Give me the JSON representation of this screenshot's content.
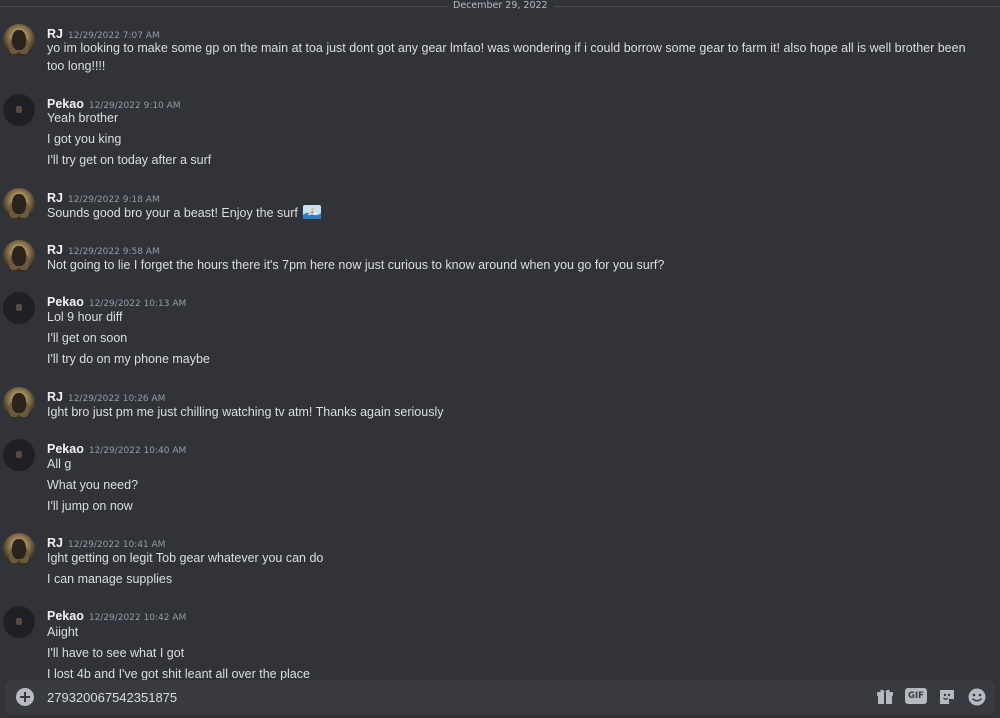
{
  "date_divider": "December 29, 2022",
  "groups": [
    {
      "author": "RJ",
      "timestamp": "12/29/2022 7:07 AM",
      "lines": [
        "yo im looking to make some gp on the main at toa just dont got any gear lmfao! was wondering if i could borrow some gear to farm it! also hope all is well brother been too long!!!!"
      ]
    },
    {
      "author": "Pekao",
      "timestamp": "12/29/2022 9:10 AM",
      "lines": [
        "Yeah brother",
        "I got you king",
        "I'll try get on today after a surf"
      ]
    },
    {
      "author": "RJ",
      "timestamp": "12/29/2022 9:18 AM",
      "lines": [
        "Sounds good bro your a beast! Enjoy the surf"
      ]
    },
    {
      "author": "RJ",
      "timestamp": "12/29/2022 9:58 AM",
      "lines": [
        "Not going to lie I forget the hours there it's 7pm here now just curious to know around when you go for you surf?"
      ]
    },
    {
      "author": "Pekao",
      "timestamp": "12/29/2022 10:13 AM",
      "lines": [
        "Lol 9 hour diff",
        "I'll get on soon",
        "I'll try do on my phone maybe"
      ]
    },
    {
      "author": "RJ",
      "timestamp": "12/29/2022 10:26 AM",
      "lines": [
        "Ight bro just pm me just chilling watching tv atm! Thanks again seriously"
      ]
    },
    {
      "author": "Pekao",
      "timestamp": "12/29/2022 10:40 AM",
      "lines": [
        "All g",
        "What you need?",
        "I'll jump on now"
      ]
    },
    {
      "author": "RJ",
      "timestamp": "12/29/2022 10:41 AM",
      "lines": [
        "Ight getting on legit Tob gear whatever you can do",
        "I can manage supplies"
      ]
    },
    {
      "author": "Pekao",
      "timestamp": "12/29/2022 10:42 AM",
      "lines": [
        "Aiight",
        "I'll have to see what I got",
        "I lost 4b and I've got shit leant all over the place"
      ]
    }
  ],
  "composer": {
    "value": "279320067542351875",
    "gif_label": "GIF"
  },
  "icons": {
    "add": "plus-circle-icon",
    "gift": "gift-icon",
    "gif": "gif-icon",
    "sticker": "sticker-icon",
    "emoji": "emoji-smile-icon",
    "surf_emoji": "surfer-emoji-icon"
  }
}
